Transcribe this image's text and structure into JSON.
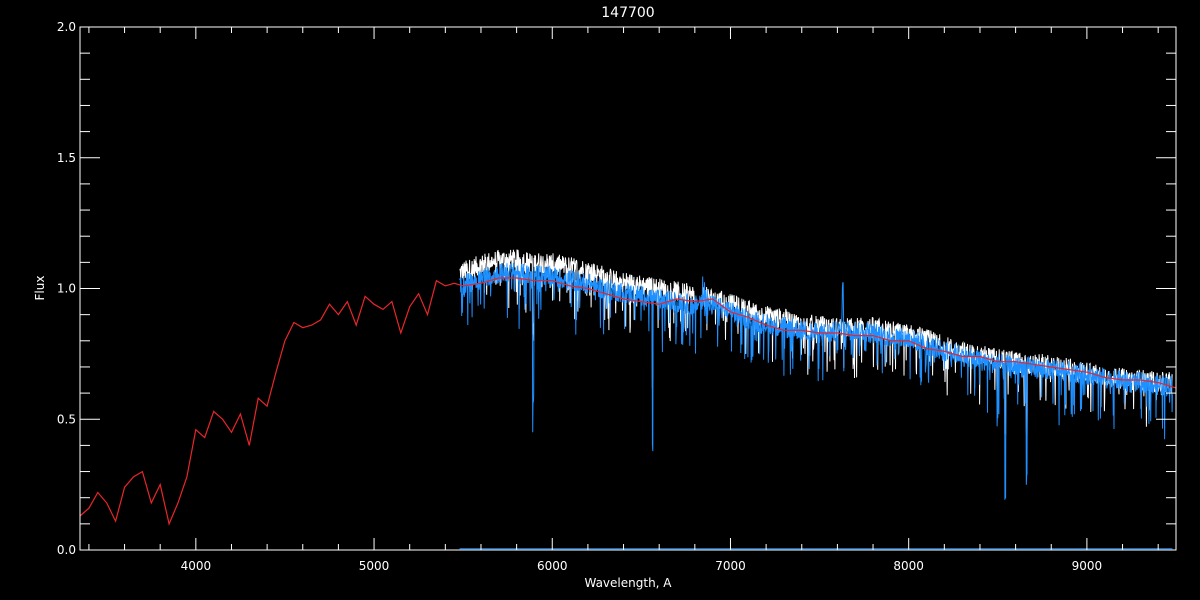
{
  "chart_data": {
    "type": "line",
    "title": "147700",
    "xlabel": "Wavelength, A",
    "ylabel": "Flux",
    "xlim": [
      3350,
      9500
    ],
    "ylim": [
      0,
      2
    ],
    "xticks": [
      4000,
      5000,
      6000,
      7000,
      8000,
      9000
    ],
    "xtick_labels": [
      "4000",
      "5000",
      "6000",
      "7000",
      "8000",
      "9000"
    ],
    "yticks": [
      0,
      0.5,
      1,
      1.5,
      2
    ],
    "ytick_labels": [
      "0.0",
      "0.5",
      "1.0",
      "1.5",
      "2.0"
    ],
    "grid": false,
    "background": "#000000",
    "axis_color": "#ffffff",
    "series": [
      {
        "color": "#ffffff",
        "style": "spectrum",
        "x": [
          5480,
          5560,
          5640,
          5720,
          5800,
          5880,
          5960,
          6040,
          6120,
          6200,
          6280,
          6360,
          6440,
          6520,
          6600,
          6680,
          6760,
          6800,
          6840,
          6920,
          7000,
          7080,
          7160,
          7240,
          7320,
          7400,
          7480,
          7560,
          7640,
          7720,
          7800,
          7880,
          7960,
          8040,
          8120,
          8200,
          8280,
          8360,
          8440,
          8520,
          8600,
          8680,
          8760,
          8840,
          8920,
          9000,
          9080,
          9160,
          9240,
          9320,
          9400,
          9480
        ],
        "y": [
          1.06,
          1.08,
          1.1,
          1.11,
          1.11,
          1.1,
          1.1,
          1.09,
          1.08,
          1.07,
          1.05,
          1.03,
          1.02,
          1.01,
          1.0,
          0.99,
          0.98,
          0.97,
          0.97,
          0.96,
          0.94,
          0.92,
          0.9,
          0.89,
          0.88,
          0.86,
          0.86,
          0.85,
          0.85,
          0.85,
          0.85,
          0.84,
          0.83,
          0.82,
          0.8,
          0.78,
          0.76,
          0.75,
          0.74,
          0.73,
          0.72,
          0.71,
          0.71,
          0.7,
          0.69,
          0.68,
          0.67,
          0.66,
          0.65,
          0.65,
          0.64,
          0.64
        ]
      },
      {
        "color": "#1e90ff",
        "style": "spectrum",
        "x": [
          5480,
          5560,
          5640,
          5720,
          5800,
          5880,
          5960,
          6040,
          6120,
          6200,
          6280,
          6360,
          6440,
          6520,
          6600,
          6680,
          6760,
          6800,
          6840,
          6920,
          7000,
          7080,
          7160,
          7240,
          7320,
          7400,
          7480,
          7560,
          7640,
          7720,
          7800,
          7880,
          7960,
          8040,
          8120,
          8200,
          8280,
          8360,
          8440,
          8520,
          8600,
          8680,
          8760,
          8840,
          8920,
          9000,
          9080,
          9160,
          9240,
          9320,
          9400,
          9480
        ],
        "y": [
          1.01,
          1.03,
          1.05,
          1.06,
          1.06,
          1.05,
          1.05,
          1.04,
          1.03,
          1.02,
          1.0,
          0.99,
          0.98,
          0.97,
          0.96,
          0.95,
          0.94,
          0.93,
          0.96,
          0.93,
          0.91,
          0.89,
          0.87,
          0.86,
          0.85,
          0.84,
          0.83,
          0.83,
          0.84,
          0.84,
          0.83,
          0.82,
          0.81,
          0.8,
          0.78,
          0.76,
          0.75,
          0.73,
          0.72,
          0.71,
          0.7,
          0.7,
          0.69,
          0.69,
          0.68,
          0.67,
          0.66,
          0.65,
          0.64,
          0.64,
          0.63,
          0.63
        ]
      },
      {
        "color": "#e8262a",
        "style": "line",
        "x": [
          3350,
          3400,
          3450,
          3500,
          3550,
          3600,
          3650,
          3700,
          3750,
          3800,
          3850,
          3900,
          3950,
          4000,
          4050,
          4100,
          4150,
          4200,
          4250,
          4300,
          4350,
          4400,
          4450,
          4500,
          4550,
          4600,
          4650,
          4700,
          4750,
          4800,
          4850,
          4900,
          4950,
          5000,
          5050,
          5100,
          5150,
          5200,
          5250,
          5300,
          5350,
          5400,
          5450,
          5500,
          5600,
          5700,
          5800,
          5900,
          6000,
          6100,
          6200,
          6300,
          6400,
          6500,
          6600,
          6700,
          6800,
          6900,
          7000,
          7100,
          7200,
          7300,
          7400,
          7500,
          7600,
          7700,
          7800,
          7900,
          8000,
          8100,
          8200,
          8300,
          8400,
          8500,
          8600,
          8700,
          8800,
          8900,
          9000,
          9100,
          9200,
          9300,
          9400,
          9500
        ],
        "y": [
          0.13,
          0.16,
          0.22,
          0.18,
          0.11,
          0.24,
          0.28,
          0.3,
          0.18,
          0.25,
          0.1,
          0.18,
          0.28,
          0.46,
          0.43,
          0.53,
          0.5,
          0.45,
          0.52,
          0.4,
          0.58,
          0.55,
          0.68,
          0.8,
          0.87,
          0.85,
          0.86,
          0.88,
          0.94,
          0.9,
          0.95,
          0.86,
          0.97,
          0.94,
          0.92,
          0.95,
          0.83,
          0.93,
          0.98,
          0.9,
          1.03,
          1.01,
          1.02,
          1.01,
          1.02,
          1.04,
          1.04,
          1.03,
          1.03,
          1.01,
          1.0,
          0.98,
          0.96,
          0.95,
          0.94,
          0.96,
          0.95,
          0.96,
          0.91,
          0.89,
          0.86,
          0.84,
          0.84,
          0.83,
          0.83,
          0.82,
          0.82,
          0.8,
          0.8,
          0.77,
          0.76,
          0.74,
          0.74,
          0.72,
          0.72,
          0.71,
          0.7,
          0.69,
          0.68,
          0.66,
          0.65,
          0.65,
          0.64,
          0.62
        ]
      }
    ]
  }
}
